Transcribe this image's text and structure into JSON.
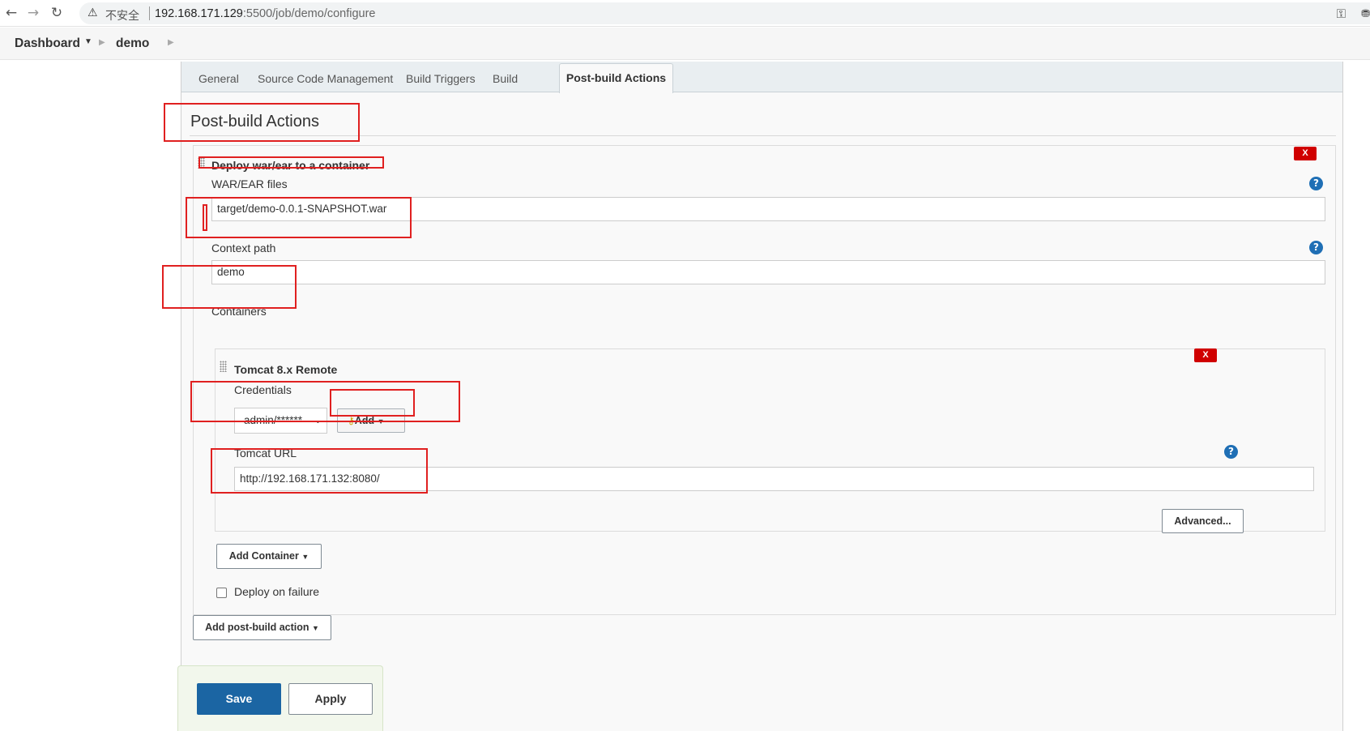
{
  "browser": {
    "security_label": "不安全",
    "url_host": "192.168.171.129",
    "url_rest": ":5500/job/demo/configure",
    "extension_label": "⛃"
  },
  "breadcrumb": {
    "items": [
      "Dashboard",
      "demo"
    ]
  },
  "tabs": [
    {
      "label": "General"
    },
    {
      "label": "Source Code Management"
    },
    {
      "label": "Build Triggers"
    },
    {
      "label": "Build"
    },
    {
      "label": "Post-build Actions"
    }
  ],
  "section_title": "Post-build Actions",
  "deploy": {
    "title": "Deploy war/ear to a container",
    "delete_label": "X",
    "war_label": "WAR/EAR files",
    "war_value": "target/demo-0.0.1-SNAPSHOT.war",
    "context_label": "Context path",
    "context_value": "demo",
    "containers_label": "Containers",
    "container": {
      "title": "Tomcat 8.x Remote",
      "delete_label": "X",
      "credentials_label": "Credentials",
      "credentials_value": "admin/******",
      "add_label": "Add",
      "url_label": "Tomcat URL",
      "url_value": "http://192.168.171.132:8080/",
      "advanced_label": "Advanced..."
    },
    "add_container_label": "Add Container",
    "deploy_on_failure_label": "Deploy on failure",
    "deploy_on_failure_checked": false
  },
  "add_post_build_label": "Add post-build action",
  "save_label": "Save",
  "apply_label": "Apply",
  "help_glyph": "?",
  "icons": {
    "back": "back-arrow-icon",
    "forward": "forward-arrow-icon",
    "reload": "reload-icon",
    "warning": "warning-icon",
    "key": "key-icon",
    "help": "help-icon",
    "grip": "drag-handle-icon"
  },
  "colors": {
    "save_button": "#1b65a3",
    "delete_button": "#d00000",
    "help_icon": "#1f6fb5",
    "annotation": "#e02020"
  }
}
